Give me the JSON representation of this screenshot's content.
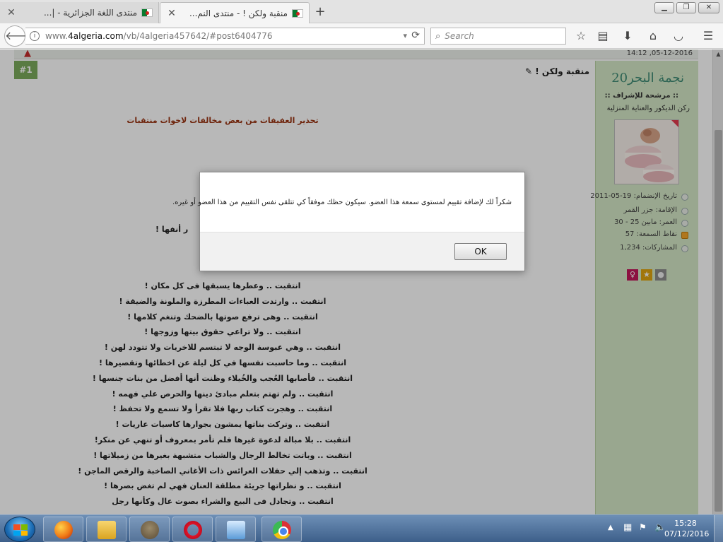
{
  "browser": {
    "tabs": [
      {
        "title": "منتدى اللغة الجزائرية - |..."
      },
      {
        "title": "منقبة ولكن ! - منتدى النم..."
      }
    ],
    "new_tab": "+",
    "url": {
      "prefix": "www.",
      "host": "4algeria.com",
      "path": "/vb/4algeria457642/#post6404776"
    },
    "search_placeholder": "Search",
    "window_controls": {
      "minimize": "▁",
      "maximize": "❐",
      "close": "✕"
    }
  },
  "post": {
    "date": "14:12 ,05-12-2016",
    "number": "#1",
    "title": "منقبة ولكن !",
    "heading": "تحذير العفيفات من بعض مخالفات لاخوات منتقبات",
    "partial_line": "ر أنفها !",
    "lines": [
      "انتقبت .. وعطرها يسبقها فى كل مكان !",
      "انتقبت .. وارتدت العباءات المطرزة والملونة والضيقة !",
      "انتقبت .. وهى ترفع صوتها بالضحك وتنغم كلامها !",
      "انتقبت .. ولا تراعي حقوق بيتها وزوجها !",
      "انتقبت .. وهي عبوسة الوجه لا تبتسم للاخريات ولا تتودد لهن !",
      "انتقبت .. وما حاسبت نفسها في كل ليلة عن اخطائها وتقصيرها !",
      "انتقبت .. فأصابها العُجب والخُيلاء وظنت أنها أفضل من بنات جنسها !",
      "انتقبت .. ولم تهتم بتعلم مبادئ دينها والحرص علي فهمه !",
      "انتقبت .. وهجرت كتاب ربها فلا تقرأ ولا تسمع ولا تحفظ !",
      "انتقبت .. وتركت بناتها يمشون بجوارها كاسيات عاريات !",
      "انتقبت .. بلا مبالة لدعوة غيرها فلم تأمر بمعروف أو تنهي عن منكر!",
      "انتقبت .. وباتت تخالط الرجال والشباب متشبهة بغيرها من زميلاتها !",
      "انتقبت .. وتذهب إلي حفلات العرائس ذات الأغاني الصاخبة والرقص الماجن !",
      "انتقبت .. و نظراتها جريئة مطلقة العنان فهي لم تغض بصرها !",
      "انتقبت .. وتجادل فى البيع والشراء بصوت عال وكأنها رجل"
    ]
  },
  "user": {
    "name": "نجمة البحر20",
    "role": ":: مرشحة للإشراف ::",
    "group": "ركن الديكور والعناية المنزلية",
    "stats": [
      {
        "label": "تاريخ الإنضمام: 19-05-2011"
      },
      {
        "label": "الإقامة: جزر القمر"
      },
      {
        "label": "العمر: مابين 25 - 30"
      },
      {
        "label": "نقاط السمعة: 57"
      },
      {
        "label": "المشاركات: 1,234"
      }
    ],
    "badges": {
      "female": "♀",
      "star": "★",
      "circle": "●"
    }
  },
  "dialog": {
    "message": "شكراً لك لإضافة تقييم لمستوى سمعة هذا العضو. سيكون حظك موفقاً كي تتلقى نفس التقييم من هذا العضو أو غيره.",
    "ok_label": "OK"
  },
  "taskbar": {
    "time": "15:28",
    "date": "07/12/2016"
  },
  "colors": {
    "post_number_bg": "#7cab5c",
    "sidebar_bg": "#d5e8c6",
    "username": "#3d8a74",
    "heading": "#9a3412"
  }
}
